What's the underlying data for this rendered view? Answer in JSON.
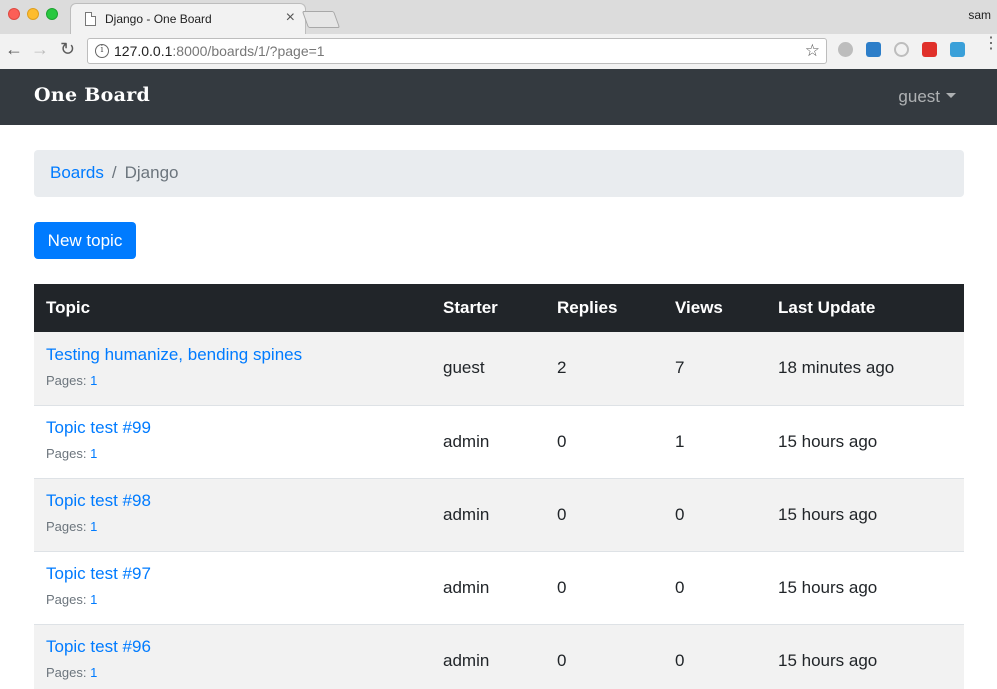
{
  "browser": {
    "tab_title": "Django - One Board",
    "tab_close": "×",
    "os_user": "sam",
    "url_host": "127.0.0.1",
    "url_path": ":8000/boards/1/?page=1"
  },
  "navbar": {
    "brand": "One Board",
    "user": "guest"
  },
  "breadcrumb": {
    "boards": "Boards",
    "separator": "/",
    "current": "Django"
  },
  "new_topic_label": "New topic",
  "table": {
    "headers": [
      "Topic",
      "Starter",
      "Replies",
      "Views",
      "Last Update"
    ],
    "pages_label": "Pages:",
    "rows": [
      {
        "topic": "Testing humanize, bending spines",
        "page": "1",
        "starter": "guest",
        "replies": "2",
        "views": "7",
        "last_update": "18 minutes ago"
      },
      {
        "topic": "Topic test #99",
        "page": "1",
        "starter": "admin",
        "replies": "0",
        "views": "1",
        "last_update": "15 hours ago"
      },
      {
        "topic": "Topic test #98",
        "page": "1",
        "starter": "admin",
        "replies": "0",
        "views": "0",
        "last_update": "15 hours ago"
      },
      {
        "topic": "Topic test #97",
        "page": "1",
        "starter": "admin",
        "replies": "0",
        "views": "0",
        "last_update": "15 hours ago"
      },
      {
        "topic": "Topic test #96",
        "page": "1",
        "starter": "admin",
        "replies": "0",
        "views": "0",
        "last_update": "15 hours ago"
      }
    ]
  },
  "colors": {
    "navbar_bg": "#343a40",
    "link": "#007bff",
    "table_head_bg": "#212529",
    "breadcrumb_bg": "#e9ecef"
  }
}
